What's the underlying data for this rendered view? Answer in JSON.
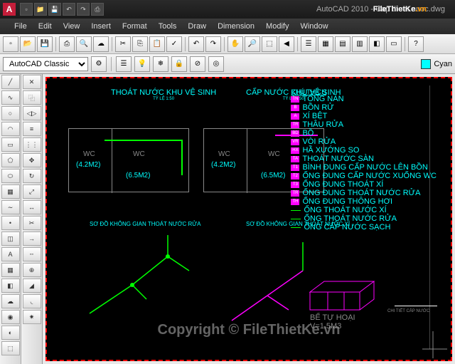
{
  "app": {
    "title": "AutoCAD 2010 - Cap thoat nuoc.dwg",
    "icon_letter": "A",
    "watermark_brand": "FileThietKe",
    "watermark_tld": ".vn"
  },
  "menu": {
    "items": [
      "File",
      "Edit",
      "View",
      "Insert",
      "Format",
      "Tools",
      "Draw",
      "Dimension",
      "Modify",
      "Window"
    ]
  },
  "workspace": {
    "selected": "AutoCAD Classic",
    "color_label": "Cyan"
  },
  "drawing": {
    "title1": "THOÁT NƯỚC KHU VỆ SINH",
    "scale1": "TỶ LỆ 1:50",
    "title2": "CẤP NƯỚC KHU VỆ SINH",
    "scale2": "TỶ LỆ 1:50",
    "wc_label": "WC",
    "area1": "(4.2M2)",
    "area2": "(6.5M2)",
    "iso1": "SƠ ĐỒ KHÔNG GIAN THOÁT NƯỚC RỬA",
    "iso2": "SƠ ĐỒ KHÔNG GIAN THOÁT NƯỚC XÍ",
    "legend_title": "CHÚ THÍCH",
    "legend_items": [
      {
        "tag": "TN",
        "label": "TỔNG NÀN"
      },
      {
        "tag": "B",
        "label": "BỒN RỬ"
      },
      {
        "tag": "A",
        "label": "XÍ BỆT"
      },
      {
        "tag": "TR",
        "label": "THÂU RỬA"
      },
      {
        "tag": "BD",
        "label": "BỒ"
      },
      {
        "tag": "VR",
        "label": "VÒI RỬA"
      },
      {
        "tag": "HX",
        "label": "HẦ XƯỚNG SO"
      },
      {
        "tag": "TA",
        "label": "THOÁT NƯỚC SÀN"
      },
      {
        "tag": "T1",
        "label": "BÌNH ĐUNG CẤP NƯỚC LÊN BỒN"
      },
      {
        "tag": "T2",
        "label": "ỐNG ĐUNG CẤP NƯỚC XUỐNG WC"
      },
      {
        "tag": "T3",
        "label": "ỐNG ĐUNG THOÁT XÍ"
      },
      {
        "tag": "TR",
        "label": "ỐNG ĐUNG THOÁT NƯỚC RỬA"
      },
      {
        "tag": "TH",
        "label": "ỐNG ĐUNG THÔNG HƠI"
      },
      {
        "tag": "",
        "label": "ỐNG THOÁT NƯỚC XÍ"
      },
      {
        "tag": "",
        "label": "ỐNG THOÁT NƯỚC RỬA"
      },
      {
        "tag": "",
        "label": "ỐNG CẤP NƯỚC SẠCH"
      }
    ],
    "septic_label": "BỂ TỰ HOẠI",
    "septic_vol": "V=1.5M3",
    "detail_label": "CHI TIẾT CẤP NƯỚC"
  },
  "copyright": "Copyright © FileThietKe.vn"
}
